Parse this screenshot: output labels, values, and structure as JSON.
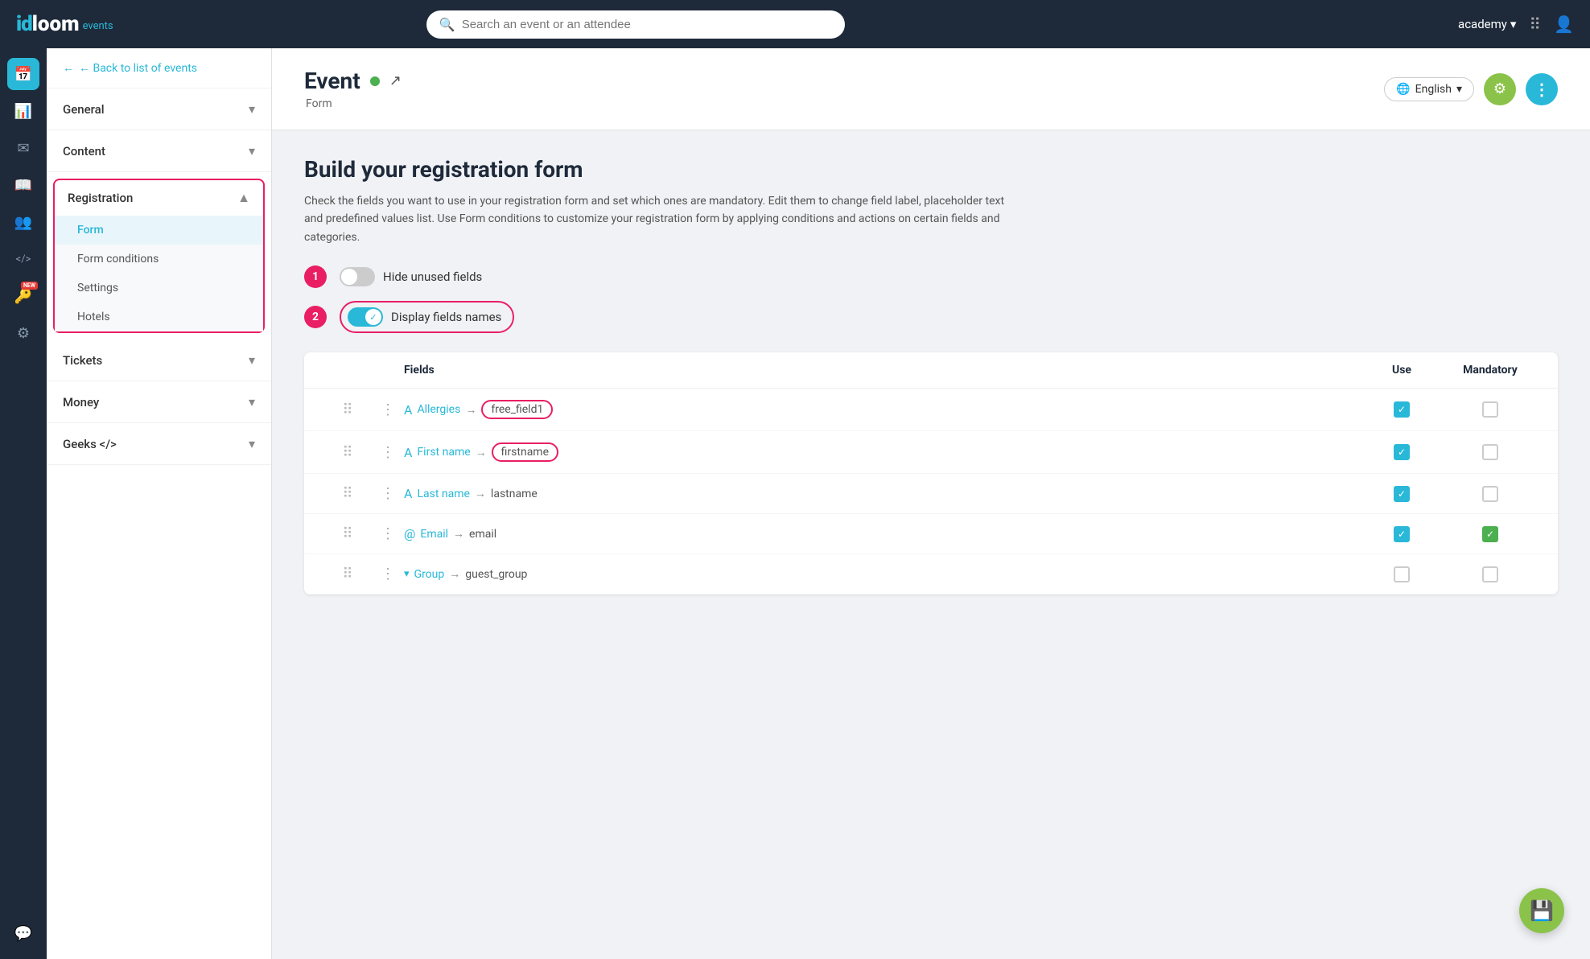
{
  "app": {
    "logo_id": "id",
    "logo_loom": "loom",
    "logo_events": "events",
    "user": "academy",
    "search_placeholder": "Search an event or an attendee"
  },
  "header": {
    "event_title": "Event",
    "event_subtitle": "Form",
    "event_status": "live",
    "lang_label": "English",
    "back_label": "← Back to list of events"
  },
  "form_builder": {
    "title": "Build your registration form",
    "description": "Check the fields you want to use in your registration form and set which ones are mandatory. Edit them to change field label, placeholder text and predefined values list. Use Form conditions to customize your registration form by applying conditions and actions on certain fields and categories.",
    "toggle_hide_unused": "Hide unused fields",
    "toggle_display_fields": "Display fields names",
    "step1_number": "1",
    "step2_number": "2"
  },
  "fields_table": {
    "col_fields": "Fields",
    "col_use": "Use",
    "col_mandatory": "Mandatory",
    "rows": [
      {
        "type_icon": "A",
        "label": "Allergies",
        "arrow": "→",
        "key": "free_field1",
        "use": true,
        "mandatory": false,
        "key_highlighted": true
      },
      {
        "type_icon": "A",
        "label": "First name",
        "arrow": "→",
        "key": "firstname",
        "use": true,
        "mandatory": false,
        "key_highlighted": true
      },
      {
        "type_icon": "A",
        "label": "Last name",
        "arrow": "→",
        "key": "lastname",
        "use": true,
        "mandatory": false,
        "key_highlighted": false
      },
      {
        "type_icon": "@",
        "label": "Email",
        "arrow": "→",
        "key": "email",
        "use": true,
        "mandatory": true,
        "key_highlighted": false
      },
      {
        "type_icon": "↓",
        "label": "Group",
        "arrow": "→",
        "key": "guest_group",
        "use": false,
        "mandatory": false,
        "key_highlighted": false
      }
    ]
  },
  "sidebar": {
    "general_label": "General",
    "content_label": "Content",
    "registration_label": "Registration",
    "form_label": "Form",
    "form_conditions_label": "Form conditions",
    "settings_label": "Settings",
    "hotels_label": "Hotels",
    "tickets_label": "Tickets",
    "money_label": "Money",
    "geeks_label": "Geeks </>"
  },
  "icons": {
    "calendar": "📅",
    "chart": "📊",
    "email": "✉",
    "book": "📖",
    "users": "👥",
    "code": "</>",
    "key_new": "🔑",
    "settings": "⚙",
    "help": "💬"
  }
}
